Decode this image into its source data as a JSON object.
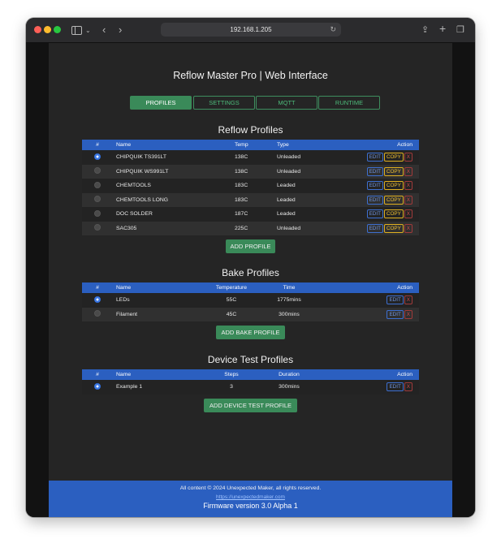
{
  "browser": {
    "url": "192.168.1.205"
  },
  "app": {
    "title": "Reflow Master Pro | Web Interface"
  },
  "tabs": [
    {
      "label": "PROFILES",
      "active": true
    },
    {
      "label": "SETTINGS",
      "active": false
    },
    {
      "label": "MQTT",
      "active": false
    },
    {
      "label": "RUNTIME",
      "active": false
    }
  ],
  "reflow": {
    "title": "Reflow Profiles",
    "headers": {
      "index": "#",
      "name": "Name",
      "temp": "Temp",
      "type": "Type",
      "action": "Action"
    },
    "rows": [
      {
        "name": "CHIPQUIK TS391LT",
        "temp": "138C",
        "type": "Unleaded",
        "selected": true
      },
      {
        "name": "CHIPQUIK WS991LT",
        "temp": "138C",
        "type": "Unleaded",
        "selected": false
      },
      {
        "name": "CHEMTOOLS",
        "temp": "183C",
        "type": "Leaded",
        "selected": false
      },
      {
        "name": "CHEMTOOLS LONG",
        "temp": "183C",
        "type": "Leaded",
        "selected": false
      },
      {
        "name": "DOC SOLDER",
        "temp": "187C",
        "type": "Leaded",
        "selected": false
      },
      {
        "name": "SAC305",
        "temp": "225C",
        "type": "Unleaded",
        "selected": false
      }
    ],
    "add_label": "ADD PROFILE"
  },
  "bake": {
    "title": "Bake Profiles",
    "headers": {
      "index": "#",
      "name": "Name",
      "temperature": "Temperature",
      "time": "Time",
      "action": "Action"
    },
    "rows": [
      {
        "name": "LEDs",
        "temperature": "55C",
        "time": "1775mins",
        "selected": true
      },
      {
        "name": "Filament",
        "temperature": "45C",
        "time": "300mins",
        "selected": false
      }
    ],
    "add_label": "ADD BAKE PROFILE"
  },
  "device_test": {
    "title": "Device Test Profiles",
    "headers": {
      "index": "#",
      "name": "Name",
      "steps": "Steps",
      "duration": "Duration",
      "action": "Action"
    },
    "rows": [
      {
        "name": "Example 1",
        "steps": "3",
        "duration": "300mins",
        "selected": true
      }
    ],
    "add_label": "ADD DEVICE TEST PROFILE"
  },
  "actions": {
    "edit": "EDIT",
    "copy": "COPY",
    "delete": "X"
  },
  "footer": {
    "copyright": "All content © 2024 Unexpected Maker, all rights reserved.",
    "link": "https://unexpectedmaker.com",
    "firmware": "Firmware version 3.0 Alpha 1"
  },
  "colors": {
    "accent_blue": "#2b5fc0",
    "accent_green": "#3a8a59",
    "copy_yellow": "#f0c030",
    "delete_red": "#d04a4a"
  }
}
